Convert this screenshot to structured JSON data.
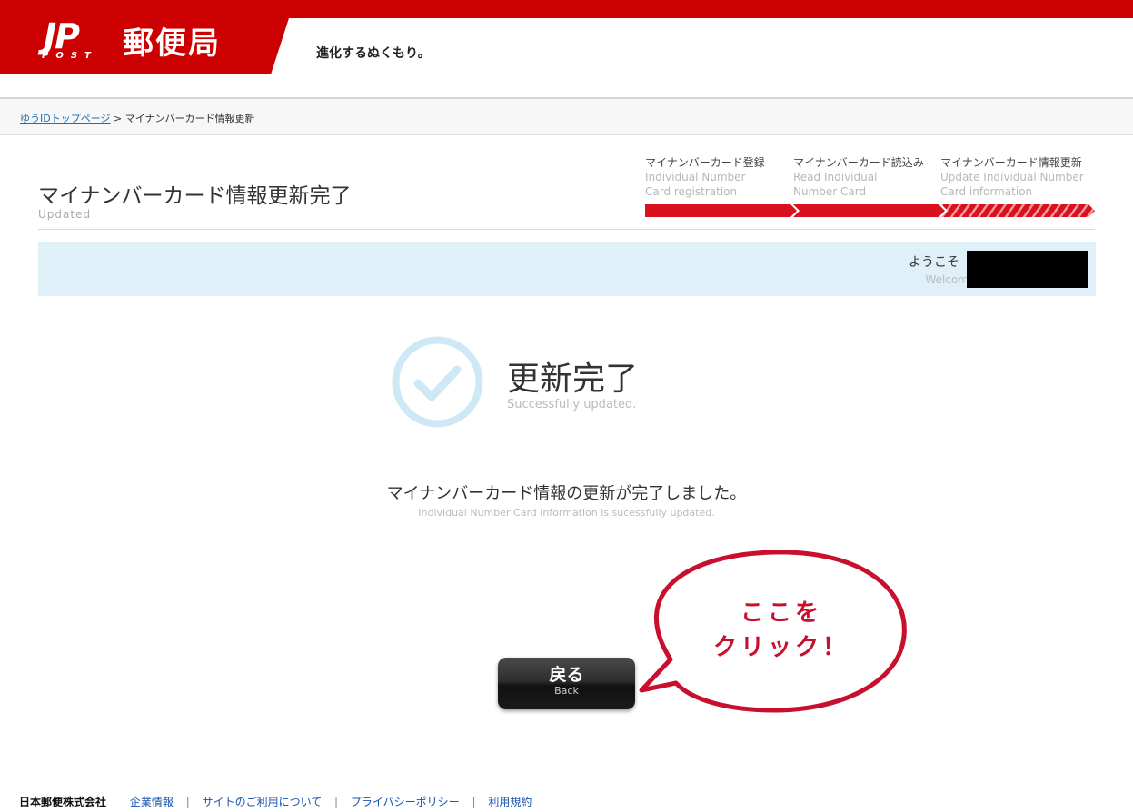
{
  "header": {
    "logo_jp": "JP",
    "logo_post": "POST",
    "logo_name": "郵便局",
    "tagline": "進化するぬくもり。"
  },
  "breadcrumb": {
    "home_link": "ゆうIDトップページ",
    "separator": ">",
    "current": "マイナンバーカード情報更新"
  },
  "page": {
    "title": "マイナンバーカード情報更新完了",
    "subtitle": "Updated"
  },
  "steps": [
    {
      "jp": "マイナンバーカード登録",
      "en": "Individual Number Card registration"
    },
    {
      "jp": "マイナンバーカード読込み",
      "en": "Read Individual Number Card"
    },
    {
      "jp": "マイナンバーカード情報更新",
      "en": "Update Individual Number Card information"
    }
  ],
  "welcome": {
    "jp": "ようこそ",
    "en": "Welcom"
  },
  "completion": {
    "title": "更新完了",
    "subtitle": "Successfully updated.",
    "message_jp": "マイナンバーカード情報の更新が完了しました。",
    "message_en": "Individual Number Card information is sucessfully updated."
  },
  "back_button": {
    "jp": "戻る",
    "en": "Back"
  },
  "callout": {
    "line1": "ここを",
    "line2": "クリック！"
  },
  "footer": {
    "company": "日本郵便株式会社",
    "links": [
      "企業情報",
      "サイトのご利用について",
      "プライバシーポリシー",
      "利用規約"
    ],
    "separator": "|"
  },
  "colors": {
    "brand_red": "#cc0000",
    "welcome_bg": "#dff0f8",
    "check_blue": "#cfe8f6",
    "callout_red": "#c8102e"
  }
}
